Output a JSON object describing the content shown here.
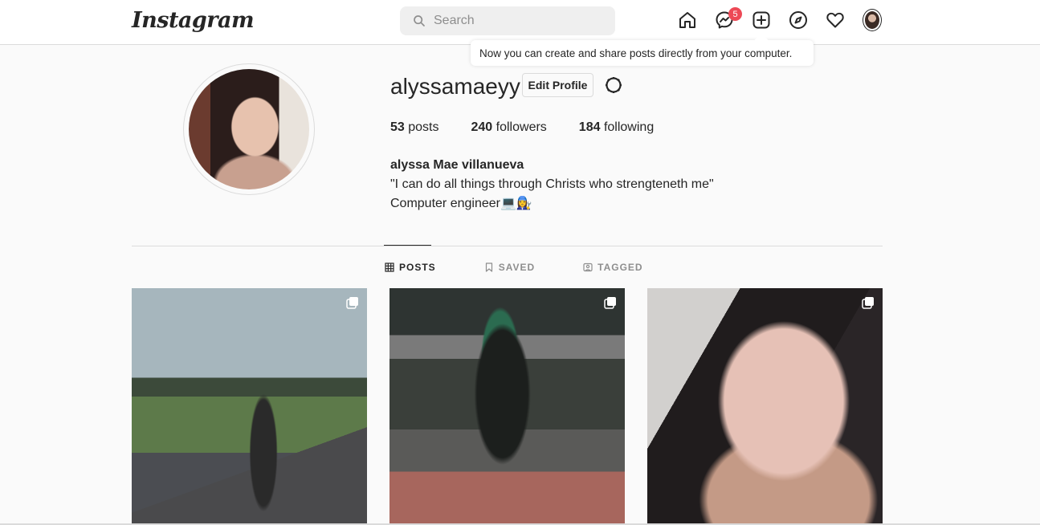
{
  "nav": {
    "logo": "Instagram",
    "search_placeholder": "Search",
    "messenger_badge": "5",
    "icons": [
      "home-icon",
      "messenger-icon",
      "new-post-icon",
      "explore-icon",
      "activity-heart-icon",
      "profile-avatar"
    ]
  },
  "tooltip": {
    "text": "Now you can create and share posts directly from your computer."
  },
  "profile": {
    "username": "alyssamaeyy",
    "edit_label": "Edit Profile",
    "stats": {
      "posts_count": "53",
      "posts_label": "posts",
      "followers_count": "240",
      "followers_label": "followers",
      "following_count": "184",
      "following_label": "following"
    },
    "full_name": "alyssa Mae villanueva",
    "bio_line1": "\"I can do all things through Christs who strengteneth me\"",
    "bio_line2": "Computer engineer💻👩‍🔧"
  },
  "tabs": [
    {
      "label": "POSTS",
      "active": true
    },
    {
      "label": "SAVED",
      "active": false
    },
    {
      "label": "TAGGED",
      "active": false
    }
  ],
  "colors": {
    "badge": "#ed4956",
    "text": "#262626",
    "muted": "#8e8e8e",
    "border": "#dbdbdb"
  }
}
